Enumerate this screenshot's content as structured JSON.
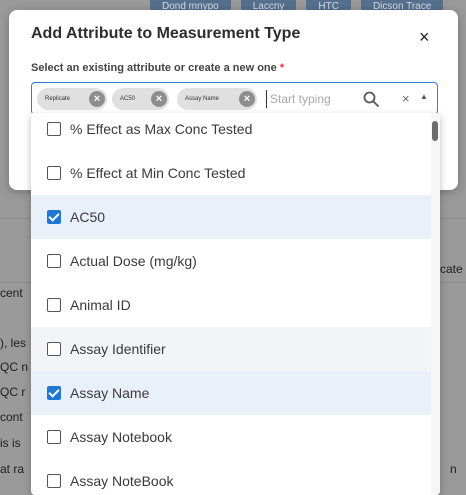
{
  "background": {
    "tabs": [
      "Dond mnypo",
      "Laccny",
      "HTC",
      "Dicson Trace"
    ],
    "fragments": [
      "cate",
      "cent",
      "), les",
      "QC n",
      "QC r",
      "cont",
      "is is",
      "at ra",
      "n"
    ]
  },
  "modal": {
    "title": "Add Attribute to Measurement Type",
    "close_label": "×",
    "field_label": "Select an existing attribute or create a new one",
    "required_mark": "*",
    "chips": [
      {
        "label": "Replicate"
      },
      {
        "label": "AC50"
      },
      {
        "label": "Assay Name"
      }
    ],
    "input_placeholder": "Start typing",
    "search_icon": "search-icon",
    "clear_label": "×",
    "caret_label": "▲"
  },
  "dropdown": {
    "options": [
      {
        "label": "% Effect as Max Conc Tested",
        "checked": false
      },
      {
        "label": "% Effect at Min Conc Tested",
        "checked": false
      },
      {
        "label": "AC50",
        "checked": true
      },
      {
        "label": "Actual Dose (mg/kg)",
        "checked": false
      },
      {
        "label": "Animal ID",
        "checked": false
      },
      {
        "label": "Assay Identifier",
        "checked": false
      },
      {
        "label": "Assay Name",
        "checked": true
      },
      {
        "label": "Assay Notebook",
        "checked": false
      },
      {
        "label": "Assay NoteBook",
        "checked": false
      }
    ]
  },
  "colors": {
    "accent": "#1e78d2",
    "selected_row": "#eaf0fa",
    "shaded_row": "#f3f4f8"
  }
}
